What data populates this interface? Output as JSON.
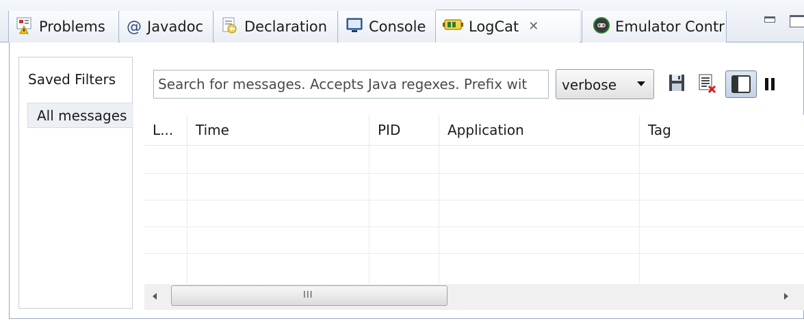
{
  "tabs": [
    {
      "label": "Problems",
      "icon": "problems-icon"
    },
    {
      "label": "Javadoc",
      "icon": "at-icon"
    },
    {
      "label": "Declaration",
      "icon": "declaration-icon"
    },
    {
      "label": "Console",
      "icon": "console-icon"
    },
    {
      "label": "LogCat",
      "icon": "logcat-icon",
      "active": true,
      "close": "✕"
    },
    {
      "label": "Emulator Contr",
      "icon": "emulator-icon"
    }
  ],
  "filters": {
    "title": "Saved Filters",
    "items": [
      "All messages"
    ]
  },
  "search": {
    "placeholder": "Search for messages. Accepts Java regexes. Prefix wit"
  },
  "level": {
    "selected": "verbose"
  },
  "table": {
    "columns": [
      "L...",
      "Time",
      "PID",
      "Application",
      "Tag"
    ],
    "rows": []
  },
  "scrollbar": {
    "grip": "III"
  },
  "colors": {
    "tab_border": "#a7b7ca",
    "toggle_bg": "#c3d3e7",
    "accent_green": "#2e7d32"
  }
}
